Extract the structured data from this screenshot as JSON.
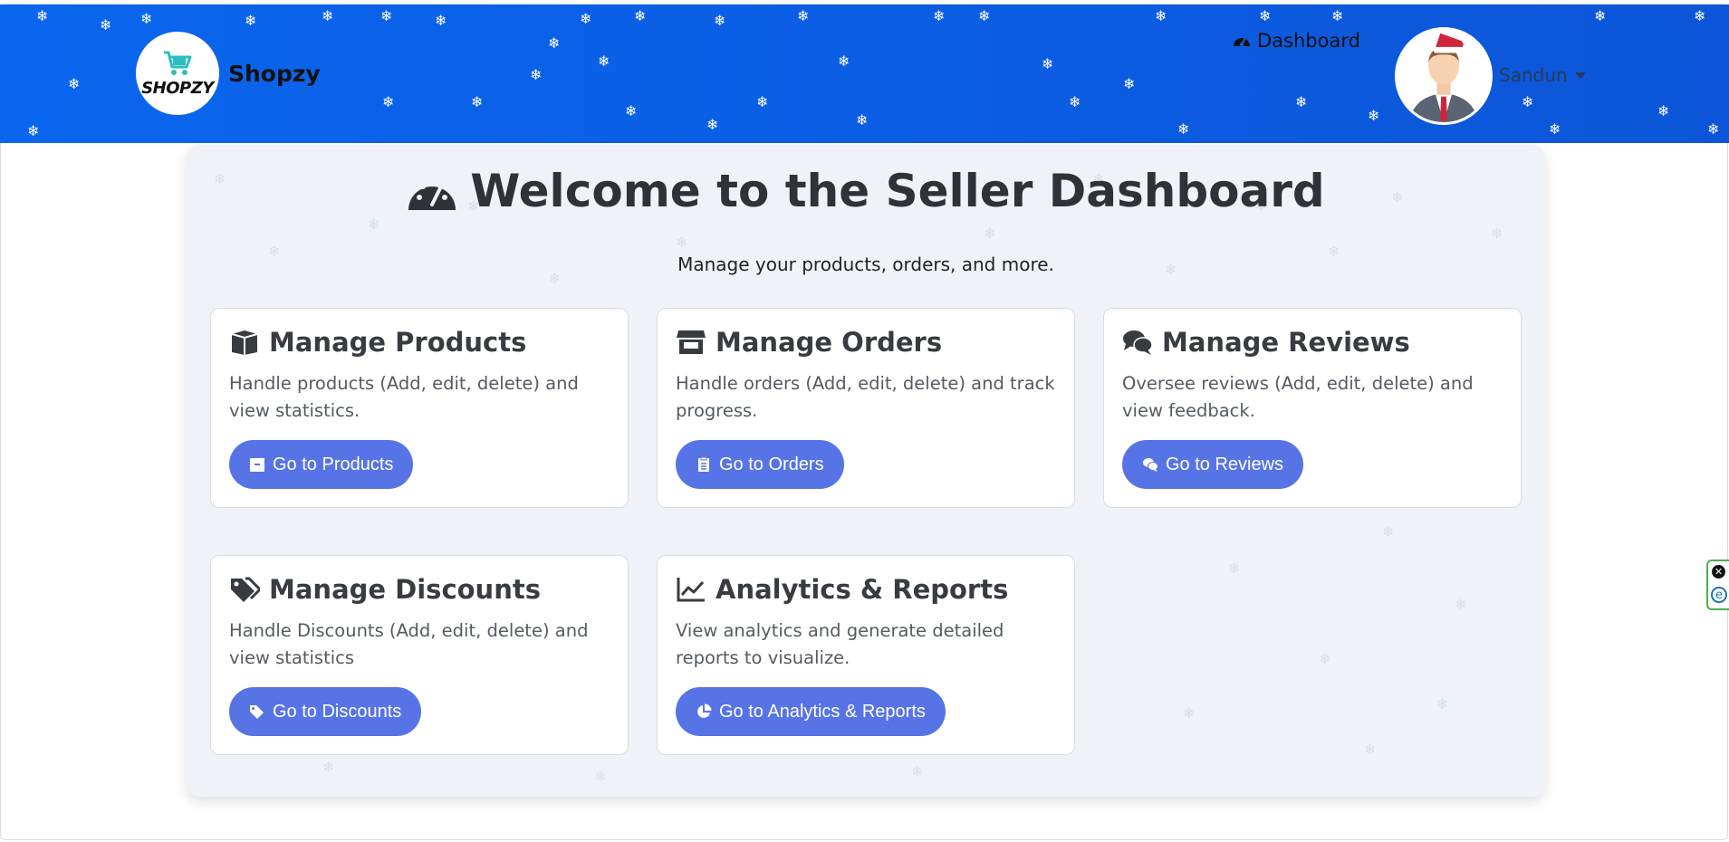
{
  "header": {
    "logo_text": "SHOPZY",
    "brand_name": "Shopzy",
    "nav_dashboard": "Dashboard",
    "user_name": "Sandun"
  },
  "main": {
    "title": "Welcome to the Seller Dashboard",
    "subtitle": "Manage your products, orders, and more.",
    "cards": [
      {
        "title": "Manage Products",
        "text": "Handle products (Add, edit, delete) and view statistics.",
        "button": "Go to Products",
        "icon": "box-open-icon",
        "button_icon": "box-icon"
      },
      {
        "title": "Manage Orders",
        "text": "Handle orders (Add, edit, delete) and track progress.",
        "button": "Go to Orders",
        "icon": "store-icon",
        "button_icon": "clipboard-list-icon"
      },
      {
        "title": "Manage Reviews",
        "text": "Oversee reviews (Add, edit, delete) and view feedback.",
        "button": "Go to Reviews",
        "icon": "comments-icon",
        "button_icon": "comments-icon"
      },
      {
        "title": "Manage Discounts",
        "text": "Handle Discounts (Add, edit, delete) and view statistics",
        "button": "Go to Discounts",
        "icon": "tags-icon",
        "button_icon": "tags-icon"
      },
      {
        "title": "Analytics & Reports",
        "text": "View analytics and generate detailed reports to visualize.",
        "button": "Go to Analytics & Reports",
        "icon": "chart-line-icon",
        "button_icon": "chart-pie-icon"
      }
    ]
  },
  "colors": {
    "header_blue": "#0a66ee",
    "button_blue": "#5774e6",
    "panel_bg": "#eff2f6",
    "title_text": "#2f3338"
  }
}
